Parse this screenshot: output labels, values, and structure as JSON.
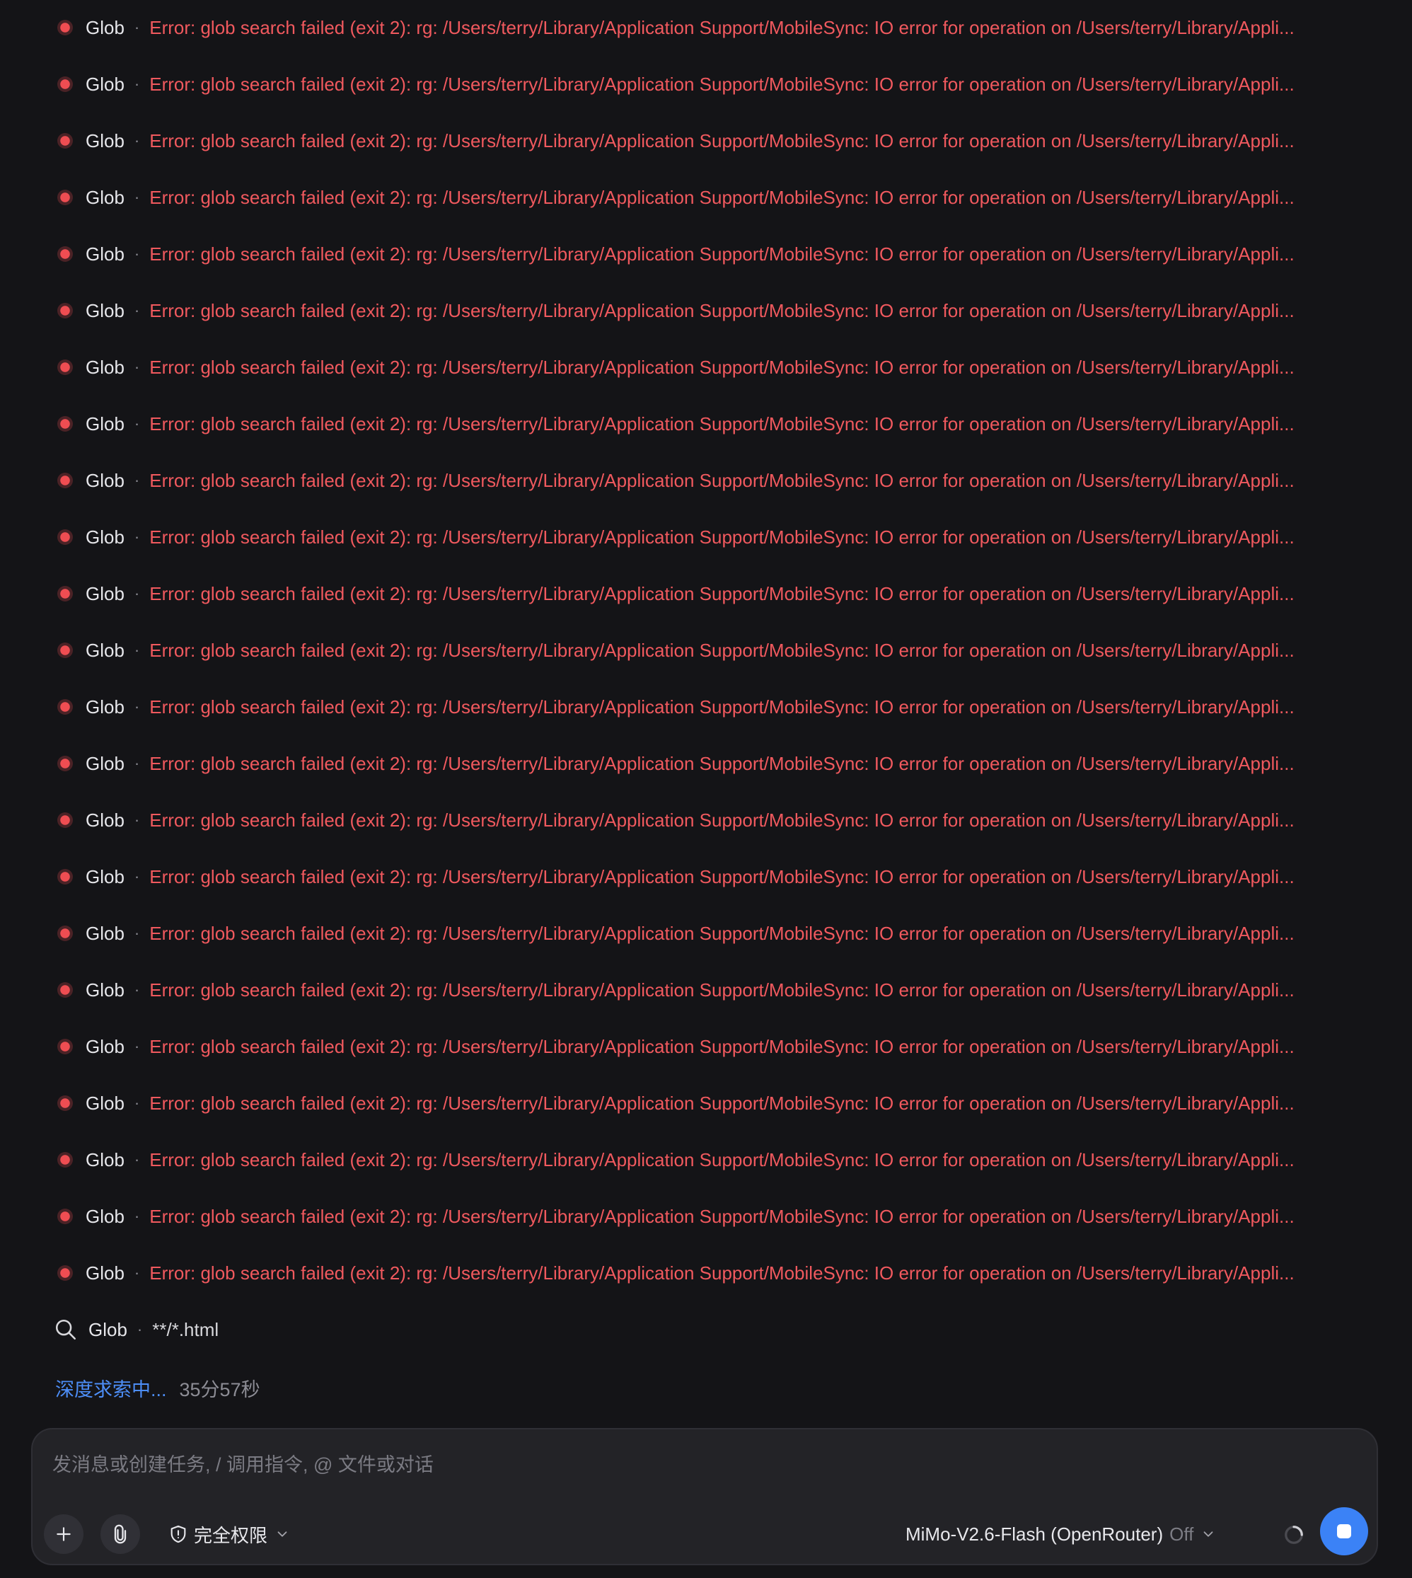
{
  "log": {
    "errors": [
      {
        "tool": "Glob",
        "separator": "·",
        "message": "Error: glob search failed (exit 2): rg: /Users/terry/Library/Application Support/MobileSync: IO error for operation on /Users/terry/Library/Appli..."
      },
      {
        "tool": "Glob",
        "separator": "·",
        "message": "Error: glob search failed (exit 2): rg: /Users/terry/Library/Application Support/MobileSync: IO error for operation on /Users/terry/Library/Appli..."
      },
      {
        "tool": "Glob",
        "separator": "·",
        "message": "Error: glob search failed (exit 2): rg: /Users/terry/Library/Application Support/MobileSync: IO error for operation on /Users/terry/Library/Appli..."
      },
      {
        "tool": "Glob",
        "separator": "·",
        "message": "Error: glob search failed (exit 2): rg: /Users/terry/Library/Application Support/MobileSync: IO error for operation on /Users/terry/Library/Appli..."
      },
      {
        "tool": "Glob",
        "separator": "·",
        "message": "Error: glob search failed (exit 2): rg: /Users/terry/Library/Application Support/MobileSync: IO error for operation on /Users/terry/Library/Appli..."
      },
      {
        "tool": "Glob",
        "separator": "·",
        "message": "Error: glob search failed (exit 2): rg: /Users/terry/Library/Application Support/MobileSync: IO error for operation on /Users/terry/Library/Appli..."
      },
      {
        "tool": "Glob",
        "separator": "·",
        "message": "Error: glob search failed (exit 2): rg: /Users/terry/Library/Application Support/MobileSync: IO error for operation on /Users/terry/Library/Appli..."
      },
      {
        "tool": "Glob",
        "separator": "·",
        "message": "Error: glob search failed (exit 2): rg: /Users/terry/Library/Application Support/MobileSync: IO error for operation on /Users/terry/Library/Appli..."
      },
      {
        "tool": "Glob",
        "separator": "·",
        "message": "Error: glob search failed (exit 2): rg: /Users/terry/Library/Application Support/MobileSync: IO error for operation on /Users/terry/Library/Appli..."
      },
      {
        "tool": "Glob",
        "separator": "·",
        "message": "Error: glob search failed (exit 2): rg: /Users/terry/Library/Application Support/MobileSync: IO error for operation on /Users/terry/Library/Appli..."
      },
      {
        "tool": "Glob",
        "separator": "·",
        "message": "Error: glob search failed (exit 2): rg: /Users/terry/Library/Application Support/MobileSync: IO error for operation on /Users/terry/Library/Appli..."
      },
      {
        "tool": "Glob",
        "separator": "·",
        "message": "Error: glob search failed (exit 2): rg: /Users/terry/Library/Application Support/MobileSync: IO error for operation on /Users/terry/Library/Appli..."
      },
      {
        "tool": "Glob",
        "separator": "·",
        "message": "Error: glob search failed (exit 2): rg: /Users/terry/Library/Application Support/MobileSync: IO error for operation on /Users/terry/Library/Appli..."
      },
      {
        "tool": "Glob",
        "separator": "·",
        "message": "Error: glob search failed (exit 2): rg: /Users/terry/Library/Application Support/MobileSync: IO error for operation on /Users/terry/Library/Appli..."
      },
      {
        "tool": "Glob",
        "separator": "·",
        "message": "Error: glob search failed (exit 2): rg: /Users/terry/Library/Application Support/MobileSync: IO error for operation on /Users/terry/Library/Appli..."
      },
      {
        "tool": "Glob",
        "separator": "·",
        "message": "Error: glob search failed (exit 2): rg: /Users/terry/Library/Application Support/MobileSync: IO error for operation on /Users/terry/Library/Appli..."
      },
      {
        "tool": "Glob",
        "separator": "·",
        "message": "Error: glob search failed (exit 2): rg: /Users/terry/Library/Application Support/MobileSync: IO error for operation on /Users/terry/Library/Appli..."
      },
      {
        "tool": "Glob",
        "separator": "·",
        "message": "Error: glob search failed (exit 2): rg: /Users/terry/Library/Application Support/MobileSync: IO error for operation on /Users/terry/Library/Appli..."
      },
      {
        "tool": "Glob",
        "separator": "·",
        "message": "Error: glob search failed (exit 2): rg: /Users/terry/Library/Application Support/MobileSync: IO error for operation on /Users/terry/Library/Appli..."
      },
      {
        "tool": "Glob",
        "separator": "·",
        "message": "Error: glob search failed (exit 2): rg: /Users/terry/Library/Application Support/MobileSync: IO error for operation on /Users/terry/Library/Appli..."
      },
      {
        "tool": "Glob",
        "separator": "·",
        "message": "Error: glob search failed (exit 2): rg: /Users/terry/Library/Application Support/MobileSync: IO error for operation on /Users/terry/Library/Appli..."
      },
      {
        "tool": "Glob",
        "separator": "·",
        "message": "Error: glob search failed (exit 2): rg: /Users/terry/Library/Application Support/MobileSync: IO error for operation on /Users/terry/Library/Appli..."
      },
      {
        "tool": "Glob",
        "separator": "·",
        "message": "Error: glob search failed (exit 2): rg: /Users/terry/Library/Application Support/MobileSync: IO error for operation on /Users/terry/Library/Appli..."
      }
    ],
    "running": {
      "tool": "Glob",
      "separator": "·",
      "pattern": "**/*.html",
      "icon": "search-icon"
    },
    "status": {
      "label": "深度求索中...",
      "elapsed": "35分57秒"
    }
  },
  "composer": {
    "placeholder": "发消息或创建任务, / 调用指令, @ 文件或对话",
    "value": "",
    "add_icon": "plus-icon",
    "attach_icon": "paperclip-icon",
    "permission": {
      "icon": "shield-icon",
      "label": "完全权限"
    },
    "model": {
      "name": "MiMo-V2.6-Flash (OpenRouter)",
      "reasoning": "Off"
    },
    "loading_icon": "spinner-icon",
    "stop_icon": "stop-icon"
  },
  "colors": {
    "background": "#141417",
    "error": "#f0595e",
    "accent": "#3b82f6",
    "status_link": "#4d8ef7",
    "muted": "#8d8d95",
    "composer_bg": "#232327"
  }
}
